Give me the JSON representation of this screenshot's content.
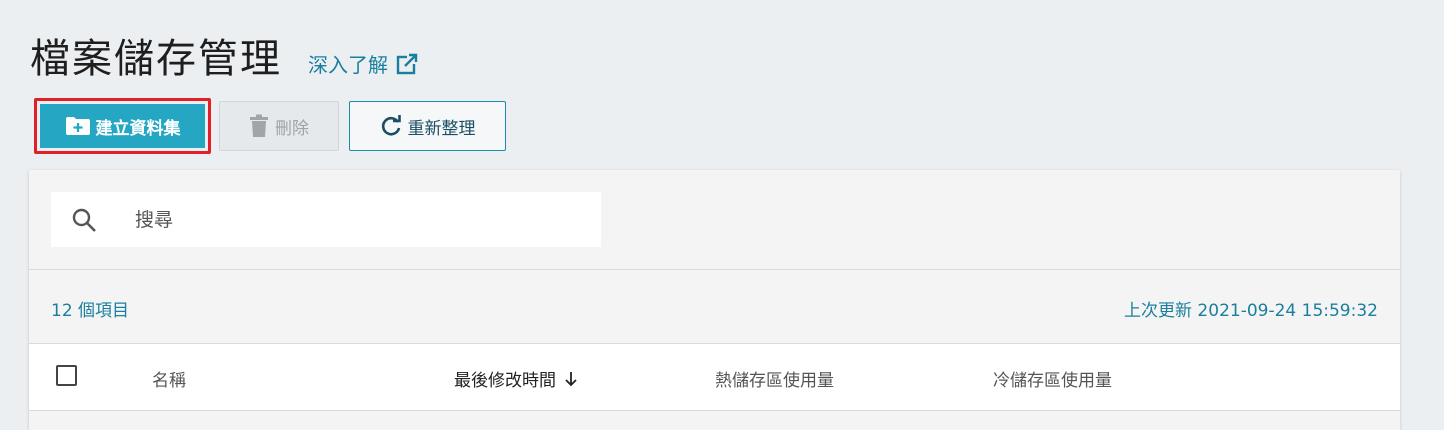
{
  "header": {
    "title": "檔案儲存管理",
    "learn_more": "深入了解"
  },
  "toolbar": {
    "create_label": "建立資料集",
    "delete_label": "刪除",
    "refresh_label": "重新整理"
  },
  "search": {
    "placeholder": "搜尋"
  },
  "summary": {
    "count_text": "12 個項目",
    "last_updated": "上次更新 2021-09-24 15:59:32"
  },
  "table": {
    "columns": [
      "名稱",
      "最後修改時間",
      "熱儲存區使用量",
      "冷儲存區使用量"
    ],
    "sort_indicator": "arrow-down-icon"
  },
  "colors": {
    "accent": "#25a7c3",
    "link": "#1a7f9e",
    "highlight_border": "#e01f26"
  }
}
